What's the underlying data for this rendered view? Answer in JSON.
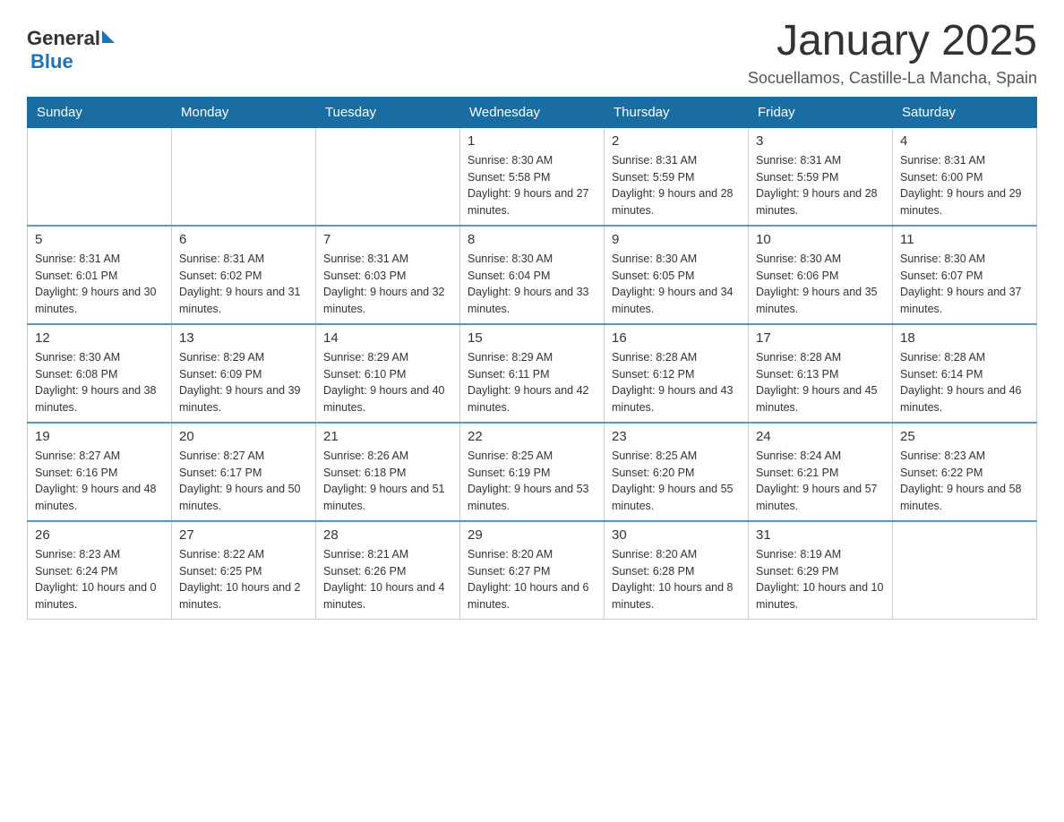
{
  "logo": {
    "text_general": "General",
    "text_blue": "Blue"
  },
  "title": "January 2025",
  "subtitle": "Socuellamos, Castille-La Mancha, Spain",
  "days_of_week": [
    "Sunday",
    "Monday",
    "Tuesday",
    "Wednesday",
    "Thursday",
    "Friday",
    "Saturday"
  ],
  "weeks": [
    [
      {
        "day": "",
        "info": ""
      },
      {
        "day": "",
        "info": ""
      },
      {
        "day": "",
        "info": ""
      },
      {
        "day": "1",
        "info": "Sunrise: 8:30 AM\nSunset: 5:58 PM\nDaylight: 9 hours and 27 minutes."
      },
      {
        "day": "2",
        "info": "Sunrise: 8:31 AM\nSunset: 5:59 PM\nDaylight: 9 hours and 28 minutes."
      },
      {
        "day": "3",
        "info": "Sunrise: 8:31 AM\nSunset: 5:59 PM\nDaylight: 9 hours and 28 minutes."
      },
      {
        "day": "4",
        "info": "Sunrise: 8:31 AM\nSunset: 6:00 PM\nDaylight: 9 hours and 29 minutes."
      }
    ],
    [
      {
        "day": "5",
        "info": "Sunrise: 8:31 AM\nSunset: 6:01 PM\nDaylight: 9 hours and 30 minutes."
      },
      {
        "day": "6",
        "info": "Sunrise: 8:31 AM\nSunset: 6:02 PM\nDaylight: 9 hours and 31 minutes."
      },
      {
        "day": "7",
        "info": "Sunrise: 8:31 AM\nSunset: 6:03 PM\nDaylight: 9 hours and 32 minutes."
      },
      {
        "day": "8",
        "info": "Sunrise: 8:30 AM\nSunset: 6:04 PM\nDaylight: 9 hours and 33 minutes."
      },
      {
        "day": "9",
        "info": "Sunrise: 8:30 AM\nSunset: 6:05 PM\nDaylight: 9 hours and 34 minutes."
      },
      {
        "day": "10",
        "info": "Sunrise: 8:30 AM\nSunset: 6:06 PM\nDaylight: 9 hours and 35 minutes."
      },
      {
        "day": "11",
        "info": "Sunrise: 8:30 AM\nSunset: 6:07 PM\nDaylight: 9 hours and 37 minutes."
      }
    ],
    [
      {
        "day": "12",
        "info": "Sunrise: 8:30 AM\nSunset: 6:08 PM\nDaylight: 9 hours and 38 minutes."
      },
      {
        "day": "13",
        "info": "Sunrise: 8:29 AM\nSunset: 6:09 PM\nDaylight: 9 hours and 39 minutes."
      },
      {
        "day": "14",
        "info": "Sunrise: 8:29 AM\nSunset: 6:10 PM\nDaylight: 9 hours and 40 minutes."
      },
      {
        "day": "15",
        "info": "Sunrise: 8:29 AM\nSunset: 6:11 PM\nDaylight: 9 hours and 42 minutes."
      },
      {
        "day": "16",
        "info": "Sunrise: 8:28 AM\nSunset: 6:12 PM\nDaylight: 9 hours and 43 minutes."
      },
      {
        "day": "17",
        "info": "Sunrise: 8:28 AM\nSunset: 6:13 PM\nDaylight: 9 hours and 45 minutes."
      },
      {
        "day": "18",
        "info": "Sunrise: 8:28 AM\nSunset: 6:14 PM\nDaylight: 9 hours and 46 minutes."
      }
    ],
    [
      {
        "day": "19",
        "info": "Sunrise: 8:27 AM\nSunset: 6:16 PM\nDaylight: 9 hours and 48 minutes."
      },
      {
        "day": "20",
        "info": "Sunrise: 8:27 AM\nSunset: 6:17 PM\nDaylight: 9 hours and 50 minutes."
      },
      {
        "day": "21",
        "info": "Sunrise: 8:26 AM\nSunset: 6:18 PM\nDaylight: 9 hours and 51 minutes."
      },
      {
        "day": "22",
        "info": "Sunrise: 8:25 AM\nSunset: 6:19 PM\nDaylight: 9 hours and 53 minutes."
      },
      {
        "day": "23",
        "info": "Sunrise: 8:25 AM\nSunset: 6:20 PM\nDaylight: 9 hours and 55 minutes."
      },
      {
        "day": "24",
        "info": "Sunrise: 8:24 AM\nSunset: 6:21 PM\nDaylight: 9 hours and 57 minutes."
      },
      {
        "day": "25",
        "info": "Sunrise: 8:23 AM\nSunset: 6:22 PM\nDaylight: 9 hours and 58 minutes."
      }
    ],
    [
      {
        "day": "26",
        "info": "Sunrise: 8:23 AM\nSunset: 6:24 PM\nDaylight: 10 hours and 0 minutes."
      },
      {
        "day": "27",
        "info": "Sunrise: 8:22 AM\nSunset: 6:25 PM\nDaylight: 10 hours and 2 minutes."
      },
      {
        "day": "28",
        "info": "Sunrise: 8:21 AM\nSunset: 6:26 PM\nDaylight: 10 hours and 4 minutes."
      },
      {
        "day": "29",
        "info": "Sunrise: 8:20 AM\nSunset: 6:27 PM\nDaylight: 10 hours and 6 minutes."
      },
      {
        "day": "30",
        "info": "Sunrise: 8:20 AM\nSunset: 6:28 PM\nDaylight: 10 hours and 8 minutes."
      },
      {
        "day": "31",
        "info": "Sunrise: 8:19 AM\nSunset: 6:29 PM\nDaylight: 10 hours and 10 minutes."
      },
      {
        "day": "",
        "info": ""
      }
    ]
  ]
}
